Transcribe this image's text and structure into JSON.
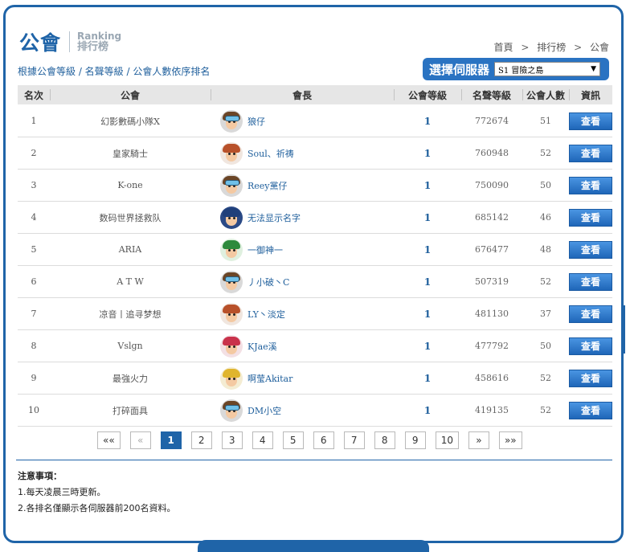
{
  "brand": {
    "title_cn": "公會",
    "title_en": "Ranking",
    "subtitle_cn": "排行榜"
  },
  "breadcrumb": [
    "首頁",
    "排行榜",
    "公會"
  ],
  "breadcrumb_sep": ">",
  "sort_description": "根據公會等級 / 名聲等級 / 公會人數依序排名",
  "server_selector": {
    "label": "選擇伺服器",
    "selected": "S1 冒險之島"
  },
  "table": {
    "headers": {
      "rank": "名次",
      "guild": "公會",
      "leader": "會長",
      "level": "公會等級",
      "fame": "名聲等級",
      "members": "公會人數",
      "info": "資訊"
    },
    "view_label": "查看",
    "rows": [
      {
        "rank": "1",
        "guild": "幻影數碼小隊X",
        "leader": "狼仔",
        "level": "1",
        "fame": "772674",
        "members": "51",
        "avatar": "goggle"
      },
      {
        "rank": "2",
        "guild": "皇家騎士",
        "leader": "Soul、祈祷",
        "level": "1",
        "fame": "760948",
        "members": "52",
        "avatar": "red-hair"
      },
      {
        "rank": "3",
        "guild": "K-one",
        "leader": "Reey黨仔",
        "level": "1",
        "fame": "750090",
        "members": "50",
        "avatar": "goggle"
      },
      {
        "rank": "4",
        "guild": "数码世界拯救队",
        "leader": "无法显示名字",
        "level": "1",
        "fame": "685142",
        "members": "46",
        "avatar": "blue-spiky"
      },
      {
        "rank": "5",
        "guild": "ARIA",
        "leader": "一御神一",
        "level": "1",
        "fame": "676477",
        "members": "48",
        "avatar": "green-hat"
      },
      {
        "rank": "6",
        "guild": "A T W",
        "leader": "丿小破丶C",
        "level": "1",
        "fame": "507319",
        "members": "52",
        "avatar": "goggle"
      },
      {
        "rank": "7",
        "guild": "凉音丨追寻梦想",
        "leader": "LY丶淡定",
        "level": "1",
        "fame": "481130",
        "members": "37",
        "avatar": "red-hair"
      },
      {
        "rank": "8",
        "guild": "Vslgn",
        "leader": "KJae溪",
        "level": "1",
        "fame": "477792",
        "members": "50",
        "avatar": "pink-hair"
      },
      {
        "rank": "9",
        "guild": "最強火力",
        "leader": "啊莹Akitar",
        "level": "1",
        "fame": "458616",
        "members": "52",
        "avatar": "blonde"
      },
      {
        "rank": "10",
        "guild": "打碎面具",
        "leader": "DM小空",
        "level": "1",
        "fame": "419135",
        "members": "52",
        "avatar": "goggle"
      }
    ]
  },
  "pagination": {
    "first": "««",
    "prev": "«",
    "pages": [
      "1",
      "2",
      "3",
      "4",
      "5",
      "6",
      "7",
      "8",
      "9",
      "10"
    ],
    "current": "1",
    "next": "»",
    "last": "»»"
  },
  "notes": {
    "title": "注意事項：",
    "items": [
      "1.每天凌晨三時更新。",
      "2.各排名僅顯示各伺服器前200名資料。"
    ]
  },
  "colors": {
    "primary": "#1f64a8",
    "button": "#2e7bd0",
    "header_bg": "#e6e6e6"
  }
}
